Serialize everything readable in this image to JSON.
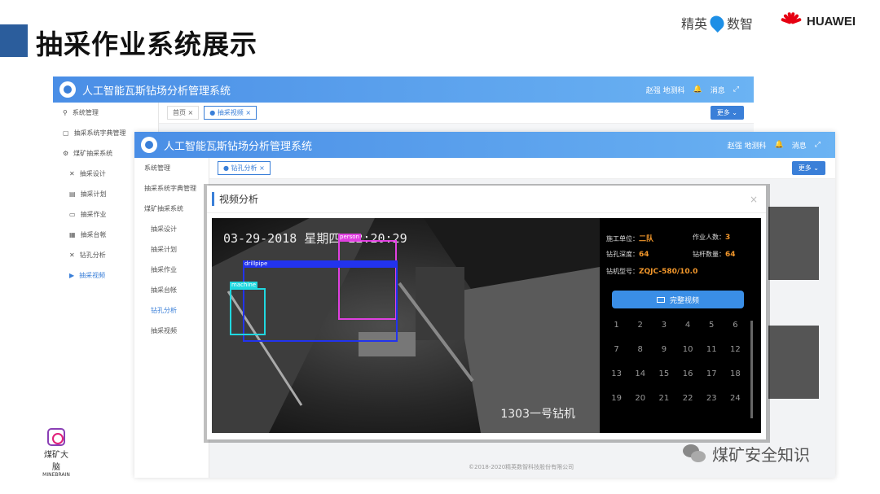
{
  "slide": {
    "title": "抽采作业系统展示",
    "brand_jingying": "精英",
    "brand_shuzhi": "数智",
    "brand_huawei": "HUAWEI",
    "mb_logo_cn": "煤矿大脑",
    "mb_logo_en": "MINEBRAIN",
    "watermark": "煤矿安全知识"
  },
  "app": {
    "title": "人工智能瓦斯钻场分析管理系统",
    "user": "赵强 地测科",
    "msg": "消息",
    "tab_home": "首页",
    "tab_video": "抽采视频",
    "more": "更多",
    "footer": "©2018-2020精英数智科技股份有限公司",
    "sidebar": [
      {
        "label": "系统管理"
      },
      {
        "label": "抽采系统字典管理"
      },
      {
        "label": "煤矿抽采系统"
      },
      {
        "label": "抽采设计"
      },
      {
        "label": "抽采计划"
      },
      {
        "label": "抽采作业"
      },
      {
        "label": "抽采台帐"
      },
      {
        "label": "钻孔分析"
      },
      {
        "label": "抽采视频"
      }
    ]
  },
  "dialog": {
    "title": "视频分析",
    "timestamp": "03-29-2018 星期四 22:20:29",
    "camera_label": "1303一号钻机",
    "boxes": {
      "person": "person",
      "drill": "drillpipe",
      "machine": "machine"
    },
    "unit_label": "施工单位：",
    "unit_value": "二队",
    "workers_label": "作业人数：",
    "workers_value": "3",
    "depth_label": "钻孔深度：",
    "depth_value": "64",
    "rods_label": "钻杆数量：",
    "rods_value": "64",
    "model_label": "钻机型号：",
    "model_value": "ZQJC-580/10.0",
    "play_label": "完整视频",
    "grid_numbers": [
      "1",
      "2",
      "3",
      "4",
      "5",
      "6",
      "7",
      "8",
      "9",
      "10",
      "11",
      "12",
      "13",
      "14",
      "15",
      "16",
      "17",
      "18",
      "19",
      "20",
      "21",
      "22",
      "23",
      "24"
    ]
  }
}
